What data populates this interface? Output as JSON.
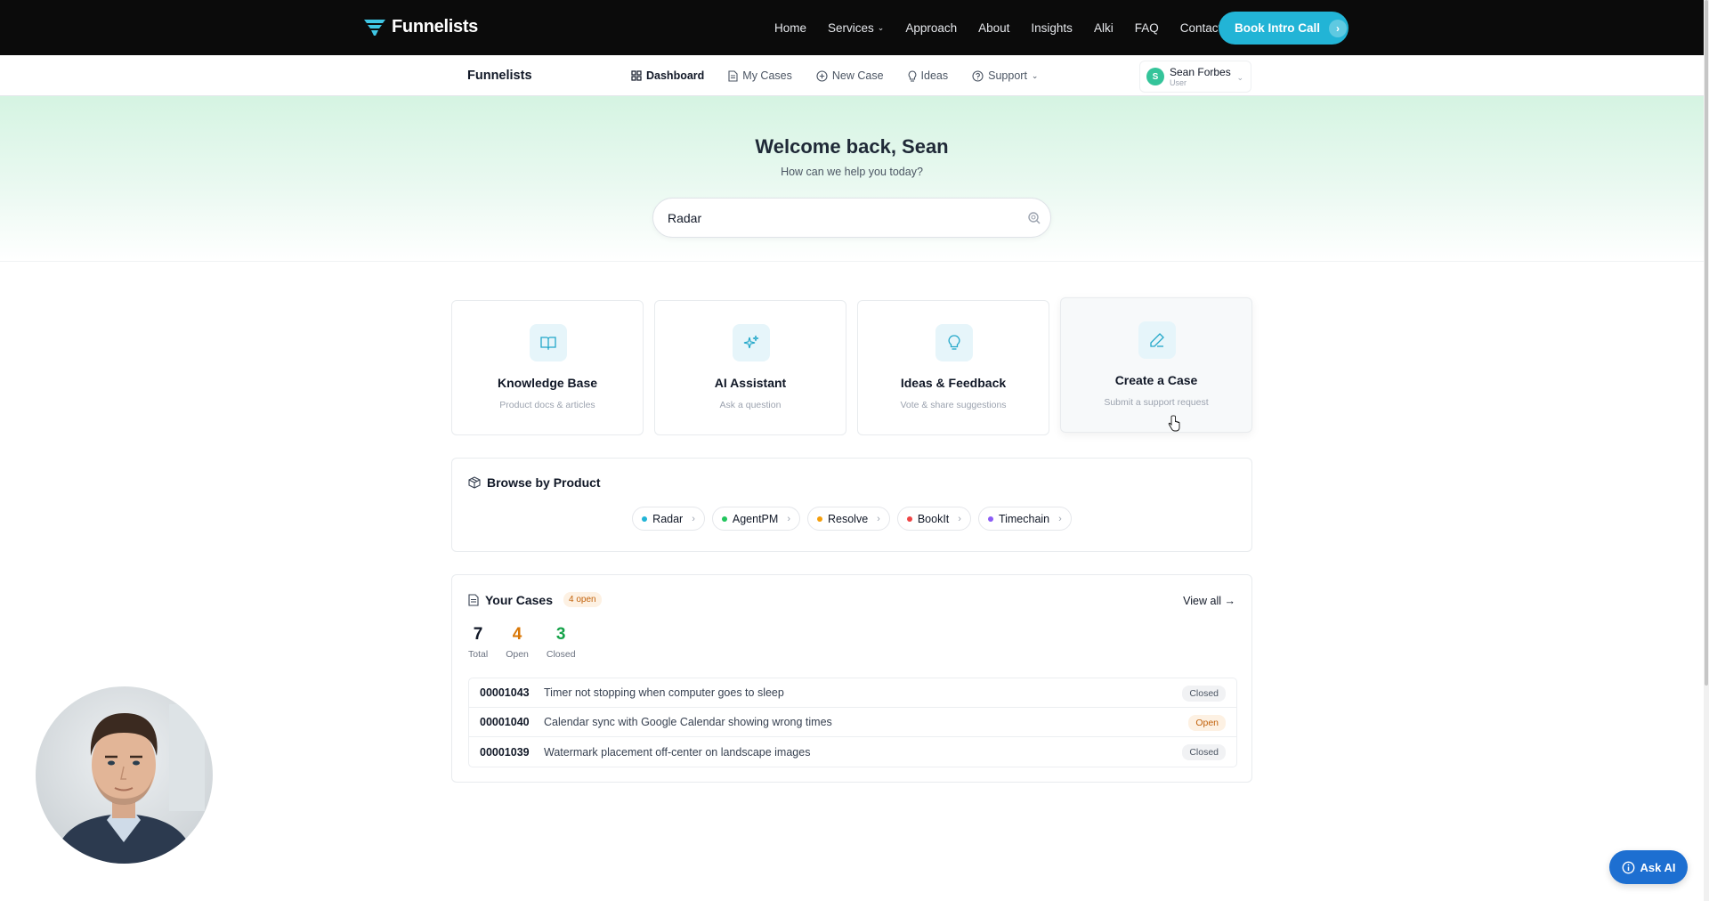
{
  "topnav": {
    "brand": "Funnelists",
    "links": [
      "Home",
      "Services",
      "Approach",
      "About",
      "Insights",
      "Alki",
      "FAQ",
      "Contact"
    ],
    "cta": "Book Intro Call"
  },
  "subnav": {
    "brand": "Funnelists",
    "items": [
      "Dashboard",
      "My Cases",
      "New Case",
      "Ideas",
      "Support"
    ],
    "user": {
      "initial": "S",
      "name": "Sean Forbes",
      "role": "User"
    }
  },
  "hero": {
    "title": "Welcome back, Sean",
    "subtitle": "How can we help you today?",
    "search_value": "Radar"
  },
  "cards": [
    {
      "title": "Knowledge Base",
      "desc": "Product docs & articles",
      "icon": "book-icon"
    },
    {
      "title": "AI Assistant",
      "desc": "Ask a question",
      "icon": "sparkles-icon"
    },
    {
      "title": "Ideas & Feedback",
      "desc": "Vote & share suggestions",
      "icon": "lightbulb-icon"
    },
    {
      "title": "Create a Case",
      "desc": "Submit a support request",
      "icon": "pencil-icon"
    }
  ],
  "browse": {
    "title": "Browse by Product",
    "products": [
      {
        "name": "Radar",
        "color": "#22b4d6"
      },
      {
        "name": "AgentPM",
        "color": "#22c55e"
      },
      {
        "name": "Resolve",
        "color": "#f59e0b"
      },
      {
        "name": "BookIt",
        "color": "#ef4444"
      },
      {
        "name": "Timechain",
        "color": "#8b5cf6"
      }
    ]
  },
  "cases": {
    "title": "Your Cases",
    "open_badge": "4 open",
    "view_all": "View all →",
    "stats": [
      {
        "value": "7",
        "label": "Total",
        "color": "#111827"
      },
      {
        "value": "4",
        "label": "Open",
        "color": "#d97706"
      },
      {
        "value": "3",
        "label": "Closed",
        "color": "#16a34a"
      }
    ],
    "rows": [
      {
        "id": "00001043",
        "title": "Timer not stopping when computer goes to sleep",
        "status": "Closed"
      },
      {
        "id": "00001040",
        "title": "Calendar sync with Google Calendar showing wrong times",
        "status": "Open"
      },
      {
        "id": "00001039",
        "title": "Watermark placement off-center on landscape images",
        "status": "Closed"
      }
    ]
  },
  "ask_ai": "Ask AI",
  "colors": {
    "accent": "#22b4d6",
    "brand_green": "#34c49a",
    "open": "#d97706",
    "closed": "#16a34a"
  }
}
